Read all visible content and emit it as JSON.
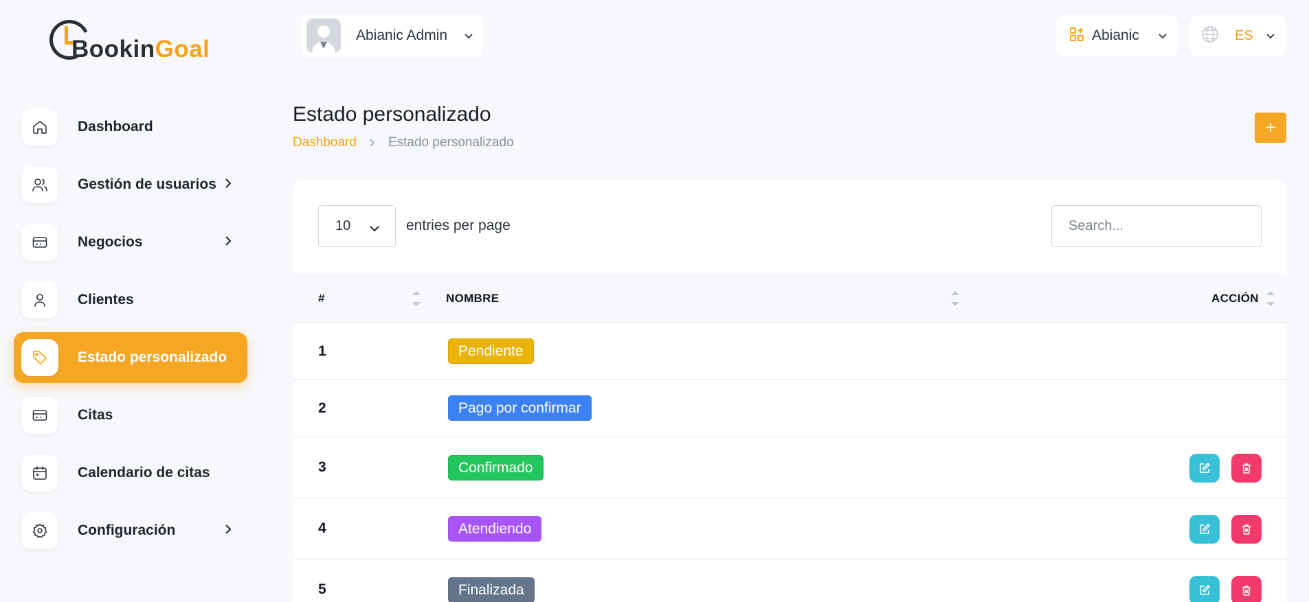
{
  "brand": {
    "part1": "Bookin",
    "part2": "Goal"
  },
  "sidebar": {
    "items": [
      {
        "label": "Dashboard",
        "icon": "home-icon"
      },
      {
        "label": "Gestión de usuarios",
        "icon": "users-icon"
      },
      {
        "label": "Negocios",
        "icon": "card-icon"
      },
      {
        "label": "Clientes",
        "icon": "user-icon"
      },
      {
        "label": "Estado personalizado",
        "icon": "tag-icon"
      },
      {
        "label": "Citas",
        "icon": "card-icon"
      },
      {
        "label": "Calendario de citas",
        "icon": "calendar-icon"
      },
      {
        "label": "Configuración",
        "icon": "gear-icon"
      }
    ],
    "active": "Estado personalizado"
  },
  "header": {
    "user_name": "Abianic Admin",
    "business": "Abianic",
    "language": "ES"
  },
  "page": {
    "title": "Estado personalizado",
    "breadcrumb": [
      "Dashboard",
      "Estado personalizado"
    ],
    "add_label": "+"
  },
  "table": {
    "per_page": "10",
    "per_page_label": "entries per page",
    "search_placeholder": "Search...",
    "columns": [
      "#",
      "NOMBRE",
      "ACCIÓN"
    ],
    "rows": [
      {
        "num": "1",
        "name": "Pendiente",
        "color": "#eab308",
        "actions": false
      },
      {
        "num": "2",
        "name": "Pago por confirmar",
        "color": "#3b82f6",
        "actions": false
      },
      {
        "num": "3",
        "name": "Confirmado",
        "color": "#22c55e",
        "actions": true
      },
      {
        "num": "4",
        "name": "Atendiendo",
        "color": "#a855f7",
        "actions": true
      },
      {
        "num": "5",
        "name": "Finalizada",
        "color": "#64748b",
        "actions": true
      }
    ]
  },
  "colors": {
    "accent": "#f5a623",
    "edit": "#38c0d8",
    "delete": "#f13a6b"
  }
}
